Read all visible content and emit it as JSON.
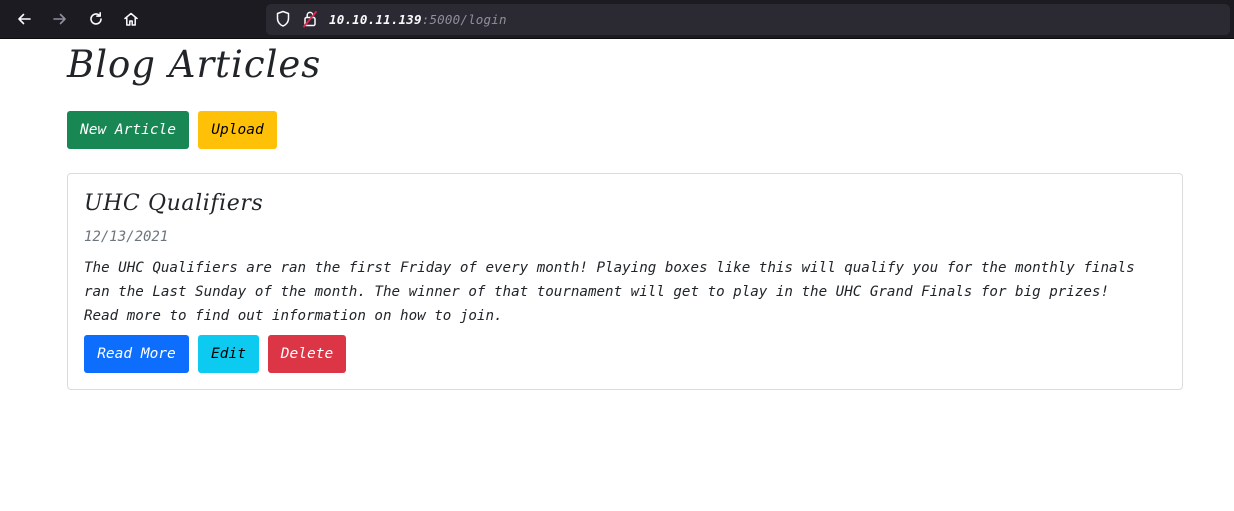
{
  "browser": {
    "url_host": "10.10.11.139",
    "url_rest": ":5000/login",
    "icons": [
      "back-arrow-icon",
      "forward-arrow-icon",
      "reload-icon",
      "home-icon",
      "shield-icon",
      "insecure-lock-icon"
    ]
  },
  "page": {
    "title": "Blog Articles",
    "actions": {
      "new_article_label": "New Article",
      "upload_label": "Upload"
    },
    "articles": [
      {
        "title": "UHC Qualifiers",
        "date": "12/13/2021",
        "body": "The UHC Qualifiers are ran the first Friday of every month! Playing boxes like this will qualify you for the monthly finals ran the Last Sunday of the month. The winner of that tournament will get to play in the UHC Grand Finals for big prizes! Read more to find out information on how to join.",
        "read_more_label": "Read More",
        "edit_label": "Edit",
        "delete_label": "Delete"
      }
    ]
  },
  "colors": {
    "success": "#198754",
    "warning": "#ffc107",
    "primary": "#0d6efd",
    "info": "#0dcaf0",
    "danger": "#dc3545",
    "chrome": "#1c1b22"
  }
}
